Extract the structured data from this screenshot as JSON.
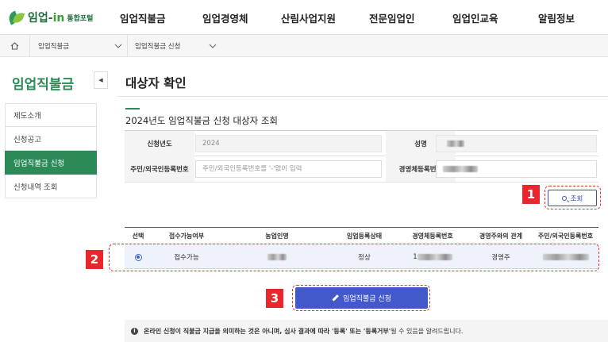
{
  "header": {
    "logo_text_a": "임업-",
    "logo_text_b": "in",
    "logo_sub": "통합포털",
    "nav": [
      "임업직불금",
      "임업경영체",
      "산림사업지원",
      "전문임업인",
      "임업인교육",
      "알림정보"
    ]
  },
  "breadcrumb": {
    "items": [
      "임업직불금",
      "임업직불금 신청"
    ]
  },
  "sidebar": {
    "title": "임업직불금",
    "toggle": "◀",
    "items": [
      {
        "label": "제도소개",
        "active": false
      },
      {
        "label": "신청공고",
        "active": false
      },
      {
        "label": "임업직불금 신청",
        "active": true
      },
      {
        "label": "신청내역 조회",
        "active": false
      }
    ]
  },
  "main": {
    "page_title": "대상자 확인",
    "section_title": "2024년도 임업직불금 신청 대상자 조회",
    "form": {
      "year_label": "신청년도",
      "year_value": "2024",
      "name_label": "성명",
      "rrn_label": "주민/외국인등록번호",
      "rrn_placeholder": "주민/외국인등록번호를 '-'없이 입력",
      "biz_label": "경영체등록번호"
    },
    "search_button": "조회",
    "table": {
      "headers": [
        "선택",
        "접수가능여부",
        "농업인명",
        "임업등록상태",
        "경영체등록번호",
        "경영주와의 관계",
        "주민/외국인등록번호"
      ],
      "row": {
        "status": "접수가능",
        "reg_status": "정상",
        "biz_no_prefix": "1",
        "relation": "경영주"
      }
    },
    "apply_button": "임업직불금 신청",
    "notice": {
      "prefix": "온라인 신청이 직불금 지급을 의미하는 것은 아니며, 심사 결과에 따라 ",
      "term1": "'등록'",
      "mid": " 또는 ",
      "term2": "'등록거부'",
      "suffix": "될 수 있음을 알려드립니다."
    }
  },
  "annotations": [
    "1",
    "2",
    "3"
  ],
  "colors": {
    "brand_green": "#2b8a57",
    "primary_blue": "#4459c9",
    "annotation_red": "#e8262b",
    "selected_row": "#eef2fb"
  }
}
